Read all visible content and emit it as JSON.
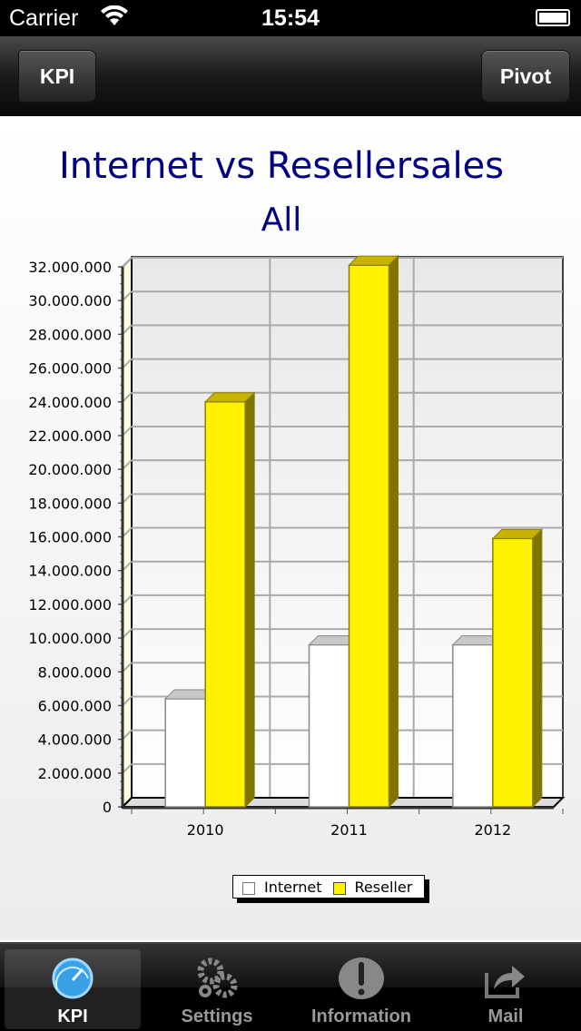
{
  "status": {
    "carrier": "Carrier",
    "time": "15:54"
  },
  "nav": {
    "back_label": "KPI",
    "right_label": "Pivot"
  },
  "chart_data": {
    "type": "bar",
    "title": "Internet vs Resellersales",
    "subtitle": "All",
    "categories": [
      "2010",
      "2011",
      "2012"
    ],
    "series": [
      {
        "name": "Internet",
        "values": [
          6400000,
          9600000,
          9600000
        ],
        "color": "#ffffff"
      },
      {
        "name": "Reseller",
        "values": [
          24000000,
          32100000,
          15900000
        ],
        "color": "#fff200"
      }
    ],
    "ylim": [
      0,
      32000000
    ],
    "yticks": [
      "0",
      "2.000.000",
      "4.000.000",
      "6.000.000",
      "8.000.000",
      "10.000.000",
      "12.000.000",
      "14.000.000",
      "16.000.000",
      "18.000.000",
      "20.000.000",
      "22.000.000",
      "24.000.000",
      "26.000.000",
      "28.000.000",
      "30.000.000",
      "32.000.000"
    ],
    "grid": true,
    "legend": "bottom",
    "style": "3d"
  },
  "tabs": [
    {
      "label": "KPI",
      "icon": "speedometer-icon"
    },
    {
      "label": "Settings",
      "icon": "gears-icon"
    },
    {
      "label": "Information",
      "icon": "exclamation-icon"
    },
    {
      "label": "Mail",
      "icon": "share-icon"
    }
  ]
}
